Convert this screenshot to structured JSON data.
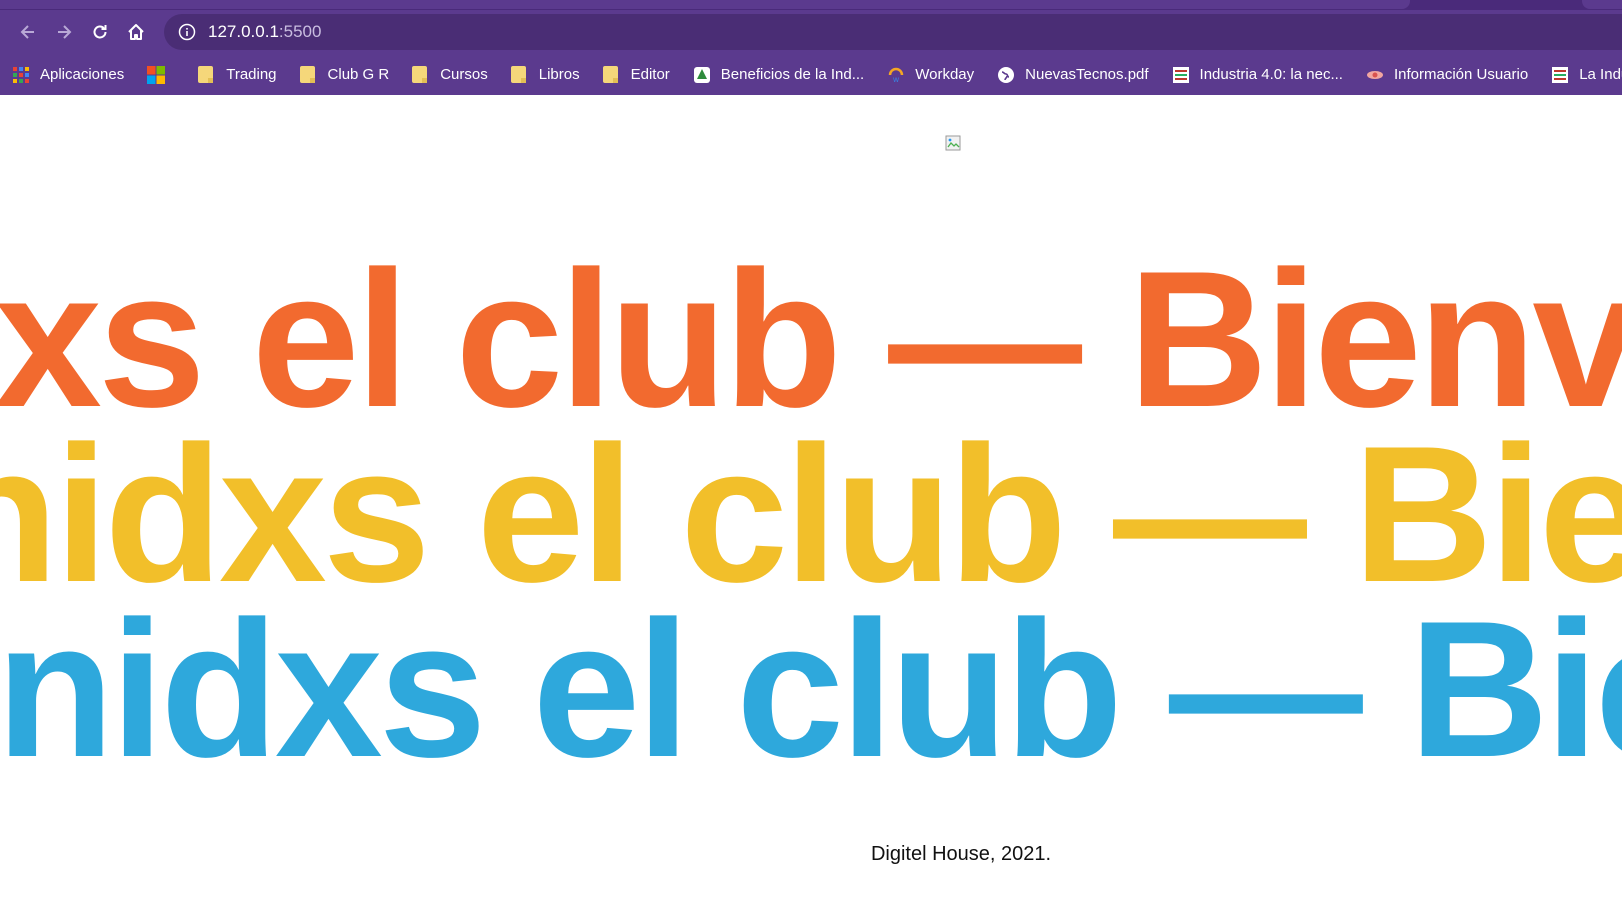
{
  "browser": {
    "address": {
      "host": "127.0.0.1",
      "port": ":5500"
    },
    "bookmarks": [
      {
        "label": "Aplicaciones",
        "icon": "apps-grid-icon"
      },
      {
        "label": "",
        "icon": "microsoft-logo-icon"
      },
      {
        "label": "Trading",
        "icon": "folder-icon"
      },
      {
        "label": "Club G R",
        "icon": "folder-icon"
      },
      {
        "label": "Cursos",
        "icon": "folder-icon"
      },
      {
        "label": "Libros",
        "icon": "folder-icon"
      },
      {
        "label": "Editor",
        "icon": "folder-icon"
      },
      {
        "label": "Beneficios de la Ind...",
        "icon": "site-icon"
      },
      {
        "label": "Workday",
        "icon": "workday-icon"
      },
      {
        "label": "NuevasTecnos.pdf",
        "icon": "globe-icon"
      },
      {
        "label": "Industria 4.0: la nec...",
        "icon": "book-icon"
      },
      {
        "label": "Información Usuario",
        "icon": "site-icon"
      },
      {
        "label": "La Industria",
        "icon": "book-icon"
      }
    ]
  },
  "page": {
    "marquee": {
      "row1": "xs el club — Bienvenidxs el club",
      "row2": "nidxs el club — Bienvenidxs el club",
      "row3": "enidxs el club — Bienvenidxs el club"
    },
    "footer": "Digitel House, 2021."
  },
  "colors": {
    "chrome": "#5b3a8e",
    "orange": "#f26a2f",
    "yellow": "#f2bf2a",
    "blue": "#2ea8dc"
  }
}
